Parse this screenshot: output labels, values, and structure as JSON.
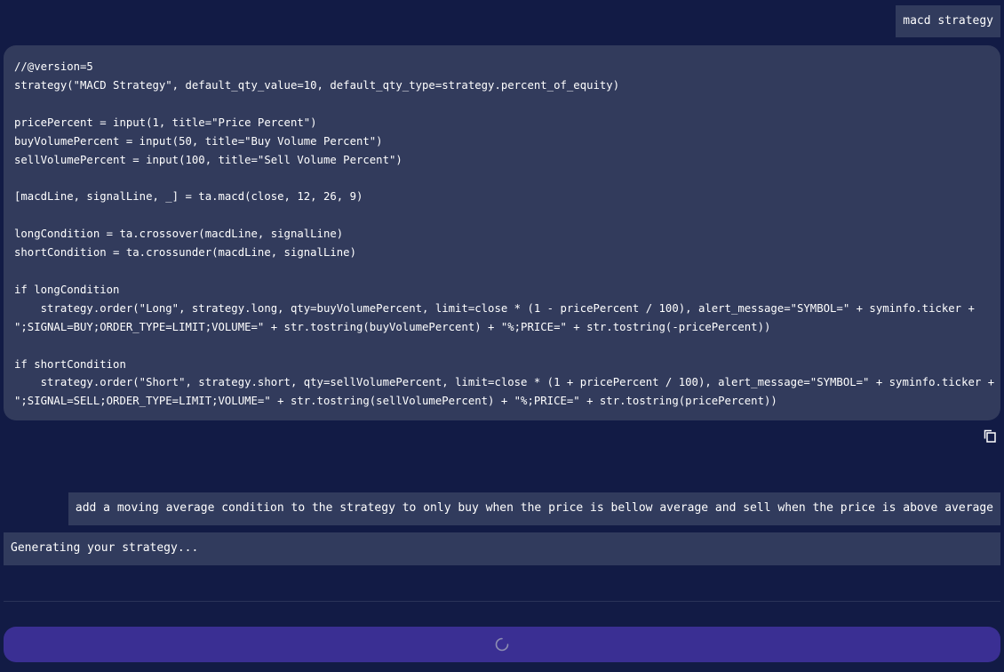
{
  "messages": {
    "user_1": "macd strategy",
    "code": "//@version=5\nstrategy(\"MACD Strategy\", default_qty_value=10, default_qty_type=strategy.percent_of_equity)\n\npricePercent = input(1, title=\"Price Percent\")\nbuyVolumePercent = input(50, title=\"Buy Volume Percent\")\nsellVolumePercent = input(100, title=\"Sell Volume Percent\")\n\n[macdLine, signalLine, _] = ta.macd(close, 12, 26, 9)\n\nlongCondition = ta.crossover(macdLine, signalLine)\nshortCondition = ta.crossunder(macdLine, signalLine)\n\nif longCondition\n    strategy.order(\"Long\", strategy.long, qty=buyVolumePercent, limit=close * (1 - pricePercent / 100), alert_message=\"SYMBOL=\" + syminfo.ticker +\n\";SIGNAL=BUY;ORDER_TYPE=LIMIT;VOLUME=\" + str.tostring(buyVolumePercent) + \"%;PRICE=\" + str.tostring(-pricePercent))\n\nif shortCondition\n    strategy.order(\"Short\", strategy.short, qty=sellVolumePercent, limit=close * (1 + pricePercent / 100), alert_message=\"SYMBOL=\" + syminfo.ticker +\n\";SIGNAL=SELL;ORDER_TYPE=LIMIT;VOLUME=\" + str.tostring(sellVolumePercent) + \"%;PRICE=\" + str.tostring(pricePercent))",
    "user_2": "add a moving average condition to the strategy to only buy when the price is bellow average and sell when the price is above average",
    "assistant_status": "Generating your strategy..."
  },
  "icons": {
    "copy": "copy-icon",
    "spinner": "loading-spinner-icon"
  },
  "colors": {
    "background": "#121b45",
    "message_bg": "#313b5d",
    "code_bg": "#323b5c",
    "submit_bg": "#3a2f93",
    "text": "#ffffff"
  }
}
